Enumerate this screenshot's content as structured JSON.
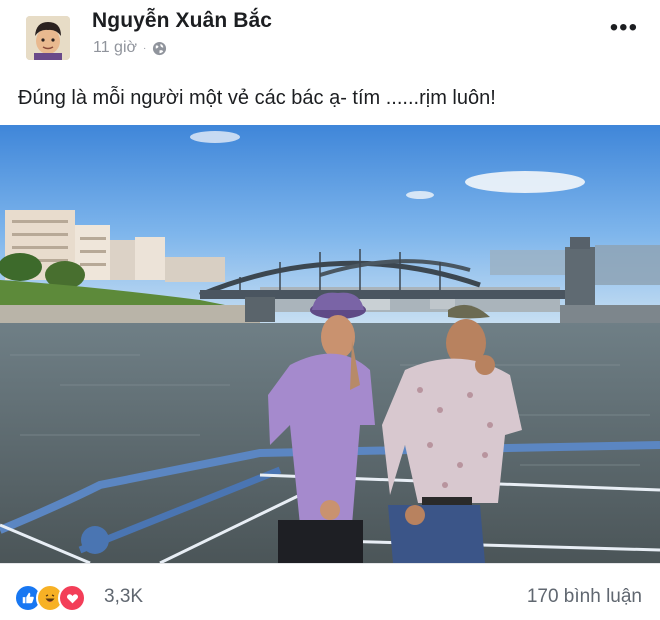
{
  "post": {
    "author": "Nguyễn Xuân Bắc",
    "time": "11 giờ",
    "separator": "·",
    "privacy_icon": "globe-icon",
    "more_icon": "more-icon",
    "more_label": "•••",
    "caption": "Đúng là mỗi người một vẻ các bác ạ- tím ......rịm luôn!"
  },
  "footer": {
    "reaction_icons": [
      "like-icon",
      "haha-icon",
      "love-icon"
    ],
    "reaction_count": "3,3K",
    "comment_count": "170 bình luận"
  },
  "colors": {
    "like": "#1877f2",
    "haha": "#f7b125",
    "love": "#f33e58",
    "meta_gray": "#90949c"
  }
}
